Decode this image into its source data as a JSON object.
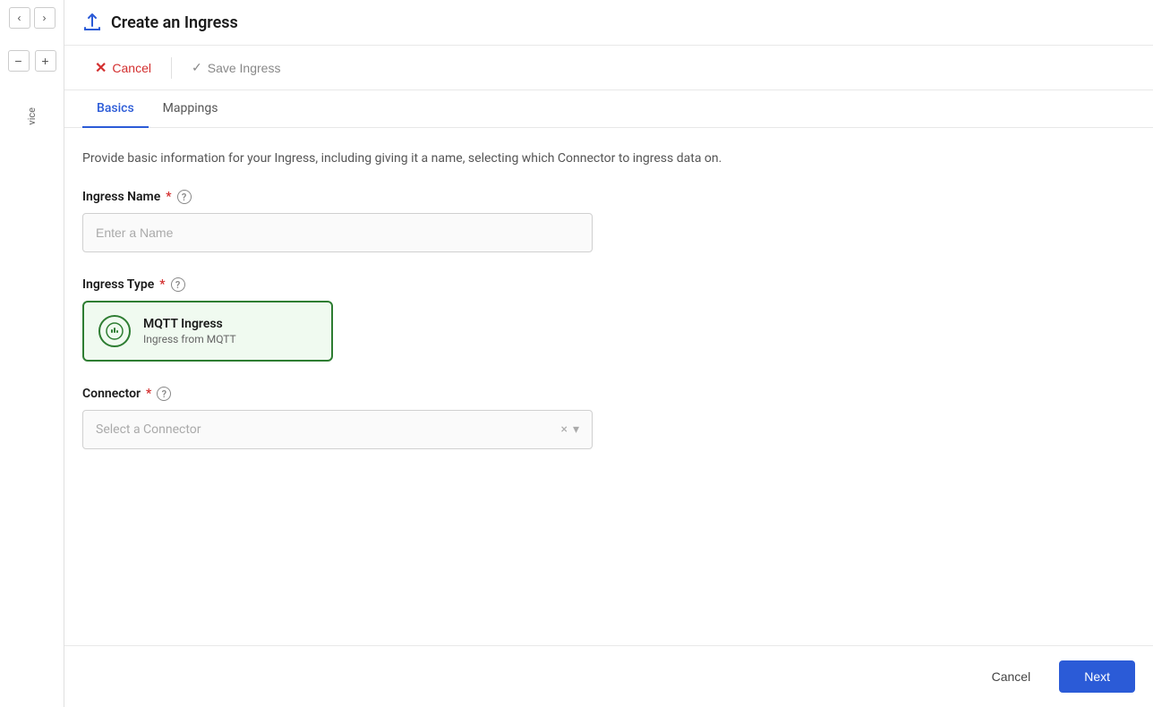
{
  "header": {
    "title": "Create an Ingress",
    "upload_icon": "↑"
  },
  "toolbar": {
    "cancel_label": "Cancel",
    "save_ingress_label": "Save Ingress"
  },
  "tabs": [
    {
      "id": "basics",
      "label": "Basics",
      "active": true
    },
    {
      "id": "mappings",
      "label": "Mappings",
      "active": false
    }
  ],
  "form": {
    "description": "Provide basic information for your Ingress, including giving it a name, selecting which Connector to ingress data on.",
    "ingress_name": {
      "label": "Ingress Name",
      "required": true,
      "placeholder": "Enter a Name"
    },
    "ingress_type": {
      "label": "Ingress Type",
      "required": true,
      "options": [
        {
          "id": "mqtt",
          "title": "MQTT Ingress",
          "subtitle": "Ingress from MQTT",
          "selected": true
        }
      ]
    },
    "connector": {
      "label": "Connector",
      "required": true,
      "placeholder": "Select a Connector"
    }
  },
  "footer": {
    "cancel_label": "Cancel",
    "next_label": "Next"
  },
  "sidebar": {
    "label": "vice",
    "nav_prev": "‹",
    "nav_next": "›",
    "minus": "−",
    "plus": "+"
  }
}
